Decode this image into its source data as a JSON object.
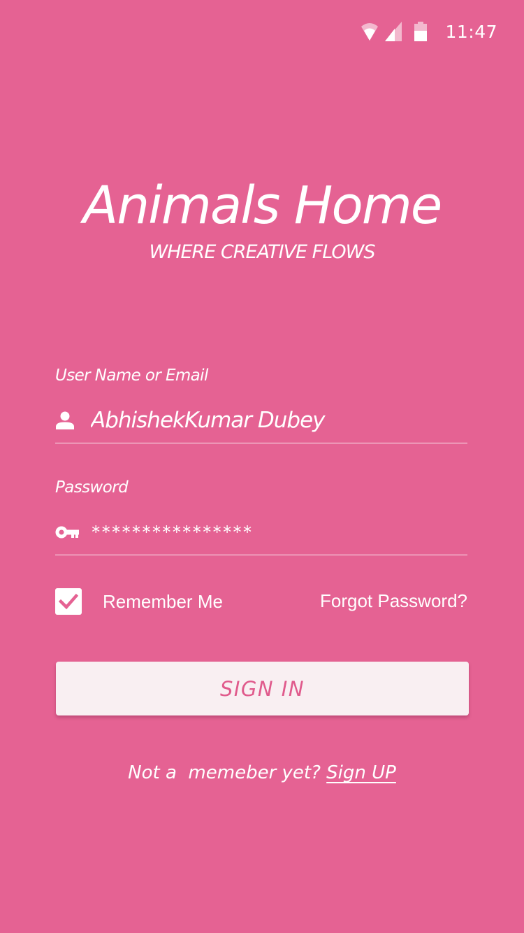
{
  "status_bar": {
    "time": "11:47",
    "icons": [
      "wifi-icon",
      "cellular-signal-icon",
      "battery-icon"
    ]
  },
  "app": {
    "title": "Animals Home",
    "tagline": "WHERE CREATIVE FLOWS"
  },
  "login_form": {
    "username_label": "User Name or Email",
    "username_value": "AbhishekKumar Dubey",
    "username_icon": "user-icon",
    "password_label": "Password",
    "password_value": "****************",
    "password_icon": "key-icon",
    "remember_me_label": "Remember Me",
    "remember_me_checked": true,
    "forgot_password_label": "Forgot Password?",
    "sign_in_label": "SIGN IN"
  },
  "signup": {
    "prompt": "Not a  memeber yet? ",
    "link_label": "Sign UP"
  },
  "colors": {
    "background": "#e56293",
    "button_background": "#f9eff2",
    "button_text": "#e05a8c",
    "text": "#ffffff"
  }
}
